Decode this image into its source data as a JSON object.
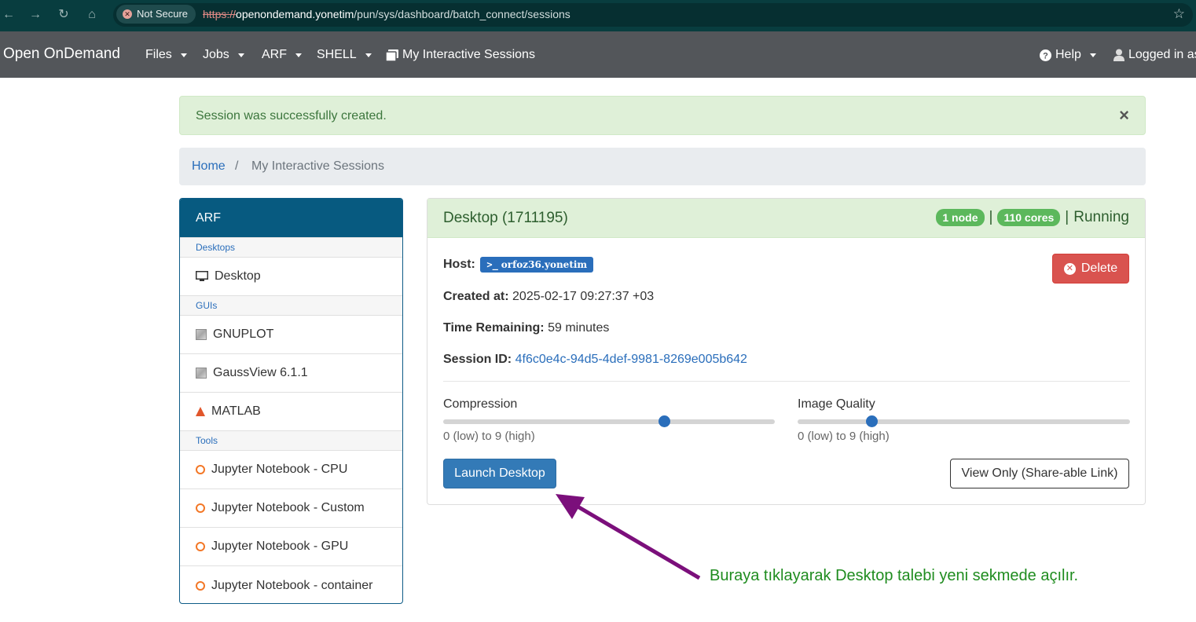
{
  "browser": {
    "security_label": "Not Secure",
    "url_scheme": "https://",
    "url_host": "openondemand.yonetim",
    "url_path": "/pun/sys/dashboard/batch_connect/sessions"
  },
  "navbar": {
    "brand": "Open OnDemand",
    "menus": [
      "Files",
      "Jobs",
      "ARF",
      "SHELL"
    ],
    "sessions_link": "My Interactive Sessions",
    "help": "Help",
    "logged_in": "Logged in as"
  },
  "alert": {
    "message": "Session was successfully created.",
    "close": "×"
  },
  "breadcrumb": {
    "home": "Home",
    "separator": "/",
    "current": "My Interactive Sessions"
  },
  "sidebar": {
    "title": "ARF",
    "categories": {
      "desktops": "Desktops",
      "guis": "GUIs",
      "tools": "Tools"
    },
    "items": {
      "desktop": "Desktop",
      "gnuplot": "GNUPLOT",
      "gaussview": "GaussView 6.1.1",
      "matlab": "MATLAB",
      "jupyter_cpu": "Jupyter Notebook - CPU",
      "jupyter_custom": "Jupyter Notebook - Custom",
      "jupyter_gpu": "Jupyter Notebook - GPU",
      "jupyter_container": "Jupyter Notebook - container"
    }
  },
  "session": {
    "title": "Desktop (1711195)",
    "nodes_badge": "1 node",
    "cores_badge": "110 cores",
    "pipe": "|",
    "status": "Running",
    "host_label": "Host:",
    "host_value": "orfoz36.yonetim",
    "created_label": "Created at:",
    "created_value": "2025-02-17 09:27:37 +03",
    "remaining_label": "Time Remaining:",
    "remaining_value": "59 minutes",
    "session_id_label": "Session ID:",
    "session_id_value": "4f6c0e4c-94d5-4def-9981-8269e005b642",
    "delete_button": "Delete",
    "compression_label": "Compression",
    "compression_hint": "0 (low) to 9 (high)",
    "compression_value": 6,
    "quality_label": "Image Quality",
    "quality_hint": "0 (low) to 9 (high)",
    "quality_value": 2,
    "launch_button": "Launch Desktop",
    "view_only_button": "View Only (Share-able Link)"
  },
  "annotation": {
    "text": "Buraya tıklayarak Desktop talebi yeni sekmede açılır.",
    "color": "#7b0f7b"
  },
  "colors": {
    "navbar": "#53565a",
    "sidebar_header": "#075a80",
    "success_bg": "#dff0d8",
    "primary": "#337ab7",
    "danger": "#d9534f",
    "badge": "#5cb85c"
  }
}
